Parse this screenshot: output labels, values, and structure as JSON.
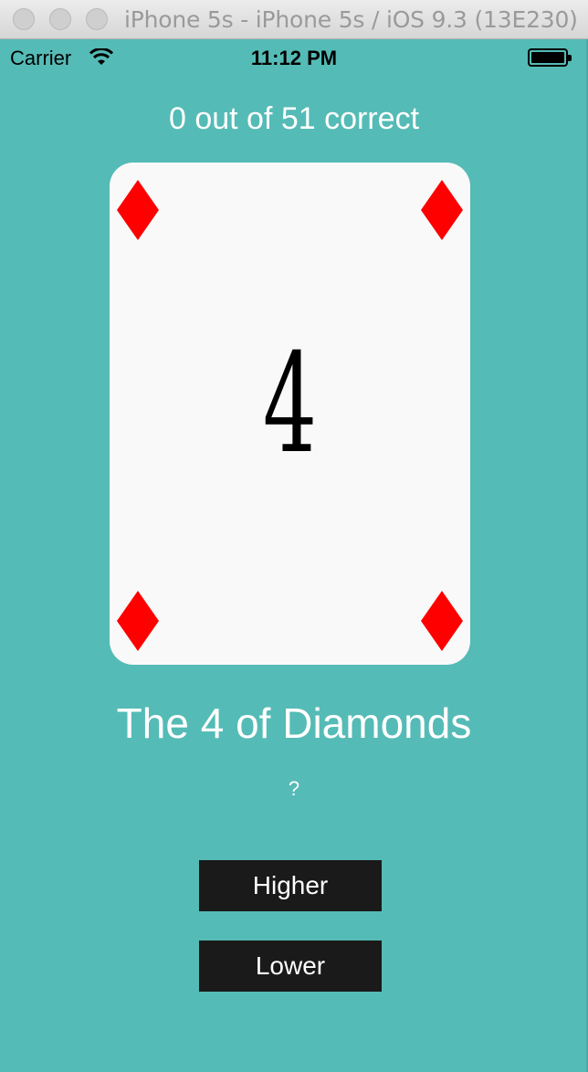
{
  "window": {
    "title": "iPhone 5s - iPhone 5s / iOS 9.3 (13E230)"
  },
  "status_bar": {
    "carrier": "Carrier",
    "time": "11:12 PM"
  },
  "game": {
    "score": "0 out of 51 correct",
    "card_rank": "4",
    "card_suit_icon": "diamond-icon",
    "card_name": "The 4 of Diamonds",
    "result": "?",
    "higher_label": "Higher",
    "lower_label": "Lower"
  },
  "colors": {
    "background": "#55bbb6",
    "card": "#f9f9f9",
    "suit": "#ff0000",
    "button": "#1a1a1a"
  }
}
